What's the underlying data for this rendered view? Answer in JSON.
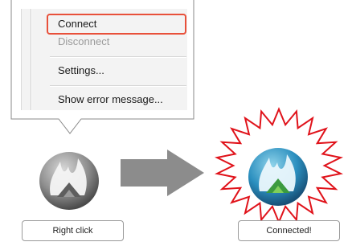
{
  "context_menu": {
    "items": [
      {
        "label": "Connect",
        "enabled": true,
        "highlighted": true
      },
      {
        "label": "Disconnect",
        "enabled": false
      },
      {
        "label": "Settings...",
        "enabled": true
      },
      {
        "label": "Show error message...",
        "enabled": true
      }
    ]
  },
  "steps": {
    "before_label": "Right click",
    "after_label": "Connected!"
  },
  "colors": {
    "highlight": "#e8503a",
    "burst": "#e0121a",
    "arrow": "#8c8c8c",
    "connected_icon": "#2b8fbf"
  }
}
